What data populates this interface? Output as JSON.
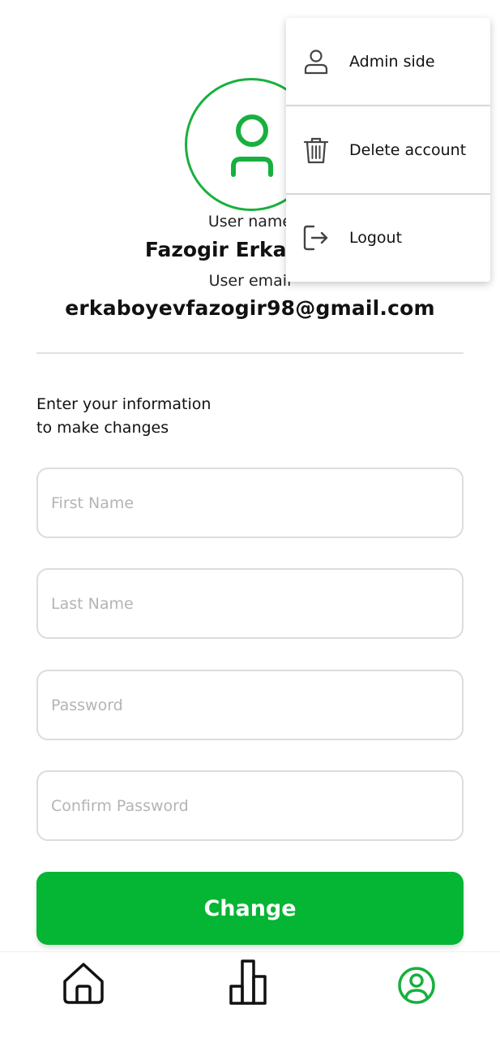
{
  "profile": {
    "user_name_label": "User name",
    "user_name": "Fazogir Erkaboyev",
    "user_email_label": "User email",
    "user_email": "erkaboyevfazogir98@gmail.com"
  },
  "form": {
    "instructions_line1": "Enter your information",
    "instructions_line2": "to make changes",
    "first_name_placeholder": "First Name",
    "last_name_placeholder": "Last Name",
    "password_placeholder": "Password",
    "confirm_password_placeholder": "Confirm Password",
    "submit_label": "Change"
  },
  "menu": {
    "items": [
      {
        "label": "Admin side",
        "icon": "person-icon"
      },
      {
        "label": "Delete account",
        "icon": "trash-icon"
      },
      {
        "label": "Logout",
        "icon": "logout-icon"
      }
    ]
  },
  "bottom_nav": {
    "items": [
      {
        "icon": "home-icon",
        "active": false
      },
      {
        "icon": "bar-chart-icon",
        "active": false
      },
      {
        "icon": "profile-icon",
        "active": true
      }
    ]
  },
  "colors": {
    "accent": "#05b534",
    "avatar_ring": "#17b03e",
    "nav_inactive": "#111111"
  }
}
